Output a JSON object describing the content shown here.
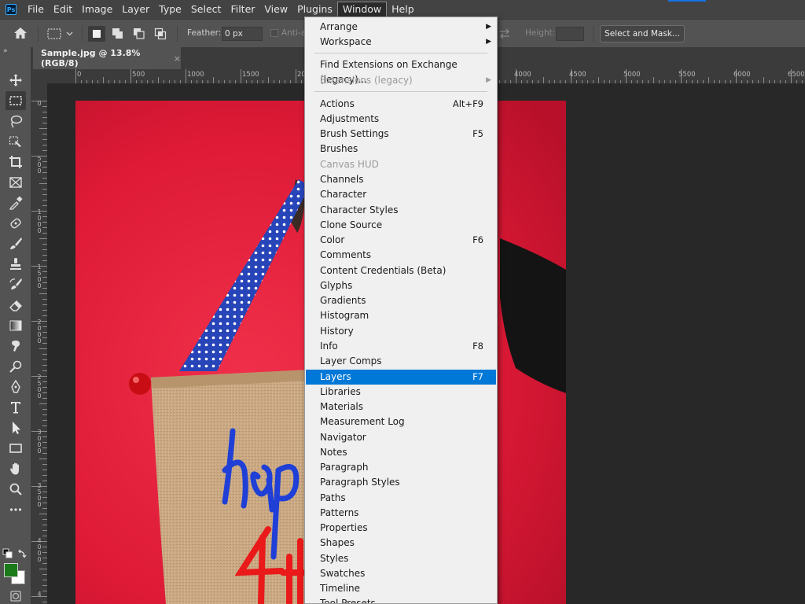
{
  "app": {
    "logo_text": "Ps"
  },
  "menubar": {
    "items": [
      "File",
      "Edit",
      "Image",
      "Layer",
      "Type",
      "Select",
      "Filter",
      "View",
      "Plugins",
      "Window",
      "Help"
    ]
  },
  "options": {
    "feather_label": "Feather:",
    "feather_value": "0 px",
    "antialias_label": "Anti-a",
    "height_label": "Height:",
    "select_mask_label": "Select and Mask..."
  },
  "toolbar": {
    "collapse_glyph": "»",
    "fg_color": "#1a7a1a",
    "bg_color": "#ffffff"
  },
  "document": {
    "tab_title": "Sample.jpg @ 13.8% (RGB/8)",
    "close_glyph": "×"
  },
  "ruler": {
    "h_labels": [
      "0",
      "500",
      "1000",
      "1500",
      "20",
      "4000",
      "4500",
      "5000",
      "5500",
      "6000",
      "6500"
    ],
    "v_labels": [
      "0",
      "500",
      "1000",
      "1500",
      "2000",
      "2500",
      "3000",
      "3500",
      "4000",
      "4"
    ]
  },
  "window_menu": {
    "items": [
      {
        "label": "Arrange",
        "submenu": true
      },
      {
        "label": "Workspace",
        "submenu": true
      },
      {
        "separator": true
      },
      {
        "label": "Find Extensions on Exchange (legacy)..."
      },
      {
        "label": "Extensions (legacy)",
        "submenu": true,
        "disabled": true
      },
      {
        "separator": true
      },
      {
        "label": "Actions",
        "shortcut": "Alt+F9"
      },
      {
        "label": "Adjustments"
      },
      {
        "label": "Brush Settings",
        "shortcut": "F5"
      },
      {
        "label": "Brushes"
      },
      {
        "label": "Canvas HUD",
        "disabled": true
      },
      {
        "label": "Channels"
      },
      {
        "label": "Character"
      },
      {
        "label": "Character Styles"
      },
      {
        "label": "Clone Source"
      },
      {
        "label": "Color",
        "shortcut": "F6"
      },
      {
        "label": "Comments"
      },
      {
        "label": "Content Credentials (Beta)"
      },
      {
        "label": "Glyphs"
      },
      {
        "label": "Gradients"
      },
      {
        "label": "Histogram"
      },
      {
        "label": "History"
      },
      {
        "label": "Info",
        "shortcut": "F8"
      },
      {
        "label": "Layer Comps"
      },
      {
        "label": "Layers",
        "shortcut": "F7",
        "highlighted": true
      },
      {
        "label": "Libraries"
      },
      {
        "label": "Materials"
      },
      {
        "label": "Measurement Log"
      },
      {
        "label": "Navigator"
      },
      {
        "label": "Notes"
      },
      {
        "label": "Paragraph"
      },
      {
        "label": "Paragraph Styles"
      },
      {
        "label": "Paths"
      },
      {
        "label": "Patterns"
      },
      {
        "label": "Properties"
      },
      {
        "label": "Shapes"
      },
      {
        "label": "Styles"
      },
      {
        "label": "Swatches"
      },
      {
        "label": "Timeline"
      },
      {
        "label": "Tool Presets"
      }
    ]
  },
  "colors": {
    "accent": "#0078d7",
    "photo_red": "#e21b3a"
  }
}
